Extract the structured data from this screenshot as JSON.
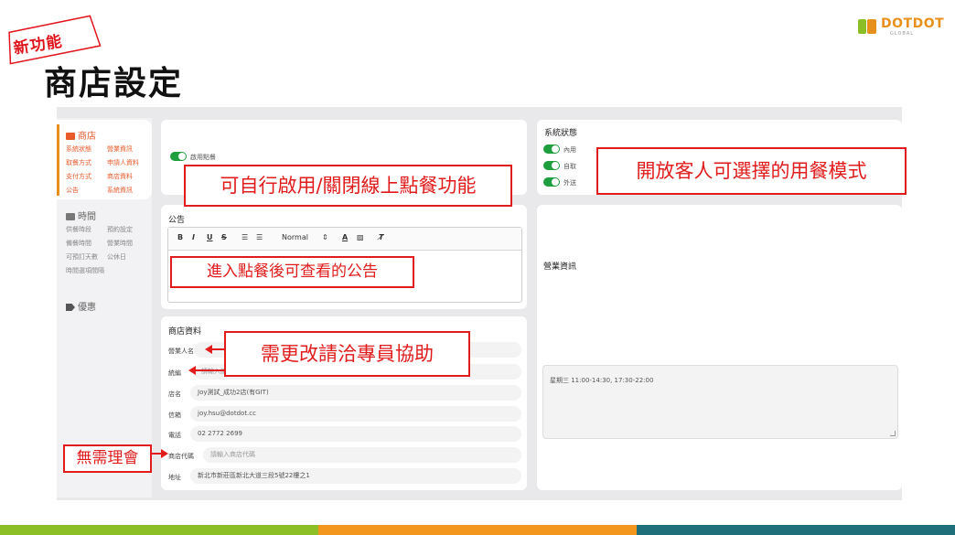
{
  "slide": {
    "badge": "新功能",
    "title": "商店設定",
    "logo": {
      "word": "DOTDOT",
      "sub": "GLOBAL"
    }
  },
  "sidebar": {
    "store": {
      "title": "商店",
      "links": [
        [
          "系統狀態",
          "營業資訊"
        ],
        [
          "取餐方式",
          "申請人資料"
        ],
        [
          "支付方式",
          "商店資料"
        ],
        [
          "公告",
          "系統資訊"
        ]
      ]
    },
    "time": {
      "title": "時間",
      "links": [
        [
          "供餐時段",
          "預約設定"
        ],
        [
          "備餐時間",
          "營業時間"
        ],
        [
          "可預訂天數",
          "公休日"
        ],
        [
          "時間選項間隔",
          ""
        ]
      ]
    },
    "promo": {
      "title": "優惠"
    }
  },
  "online_order": {
    "toggle_label": "啟用點餐"
  },
  "system_status": {
    "title": "系統狀態",
    "toggles": [
      {
        "label": "內用"
      },
      {
        "label": "自取"
      },
      {
        "label": "外送"
      }
    ]
  },
  "announcement": {
    "title": "公告",
    "toolbar": {
      "bold": "B",
      "italic": "I",
      "underline": "U",
      "strike": "S",
      "ol": "☰",
      "ul": "☰",
      "format": "Normal",
      "format_arrow": "⇕",
      "color": "A",
      "bg": "▨",
      "clear": "T̸"
    }
  },
  "business_info": {
    "title": "營業資訊",
    "hours": "星期三 11:00-14:30, 17:30-22:00"
  },
  "store_info": {
    "title": "商店資料",
    "fields": [
      {
        "label": "營業人名稱",
        "value": ""
      },
      {
        "label": "統編",
        "value": "",
        "placeholder": "請輸入統編"
      },
      {
        "label": "店名",
        "value": "Joy測試_成功2店(有GIT)"
      },
      {
        "label": "信箱",
        "value": "joy.hsu@dotdot.cc"
      },
      {
        "label": "電話",
        "value": "02 2772 2699"
      },
      {
        "label": "商店代碼",
        "value": "",
        "placeholder": "請輸入商店代碼"
      },
      {
        "label": "地址",
        "value": "新北市新莊區新北大道三段5號22樓之1"
      }
    ]
  },
  "callouts": {
    "toggle": "可自行啟用/關閉線上點餐功能",
    "dining_modes": "開放客人可選擇的用餐模式",
    "announcement": "進入點餐後可查看的公告",
    "contact": "需更改請洽專員協助",
    "ignore": "無需理會"
  },
  "colors": {
    "accent": "#e8901c",
    "toggle_on": "#1e9e3e",
    "callout": "#e01c1c",
    "stripe_green": "#8cbf26",
    "stripe_orange": "#f2961e",
    "stripe_teal": "#1f6f7a"
  }
}
